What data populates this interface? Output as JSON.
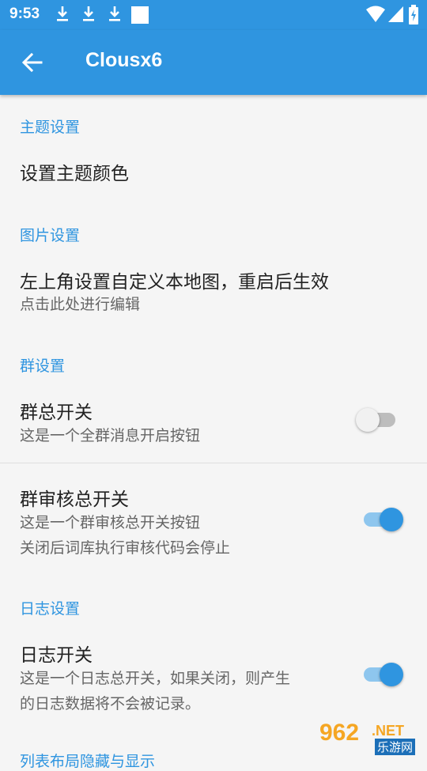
{
  "status_bar": {
    "time": "9:53"
  },
  "app_bar": {
    "title": "Clousx6"
  },
  "sections": {
    "theme": {
      "header": "主题设置",
      "item_title": "设置主题颜色"
    },
    "image": {
      "header": "图片设置",
      "item_title": "左上角设置自定义本地图，重启后生效",
      "item_subtitle": "点击此处进行编辑"
    },
    "group": {
      "header": "群设置",
      "master_switch_title": "群总开关",
      "master_switch_subtitle": "这是一个全群消息开启按钮",
      "master_switch_on": false,
      "review_switch_title": "群审核总开关",
      "review_switch_subtitle_1": "这是一个群审核总开关按钮",
      "review_switch_subtitle_2": "关闭后词库执行审核代码会停止",
      "review_switch_on": true
    },
    "log": {
      "header": "日志设置",
      "switch_title": "日志开关",
      "switch_subtitle_1": "这是一个日志总开关，如果关闭，则产生",
      "switch_subtitle_2": "的日志数据将不会被记录。",
      "switch_on": true
    },
    "list": {
      "header": "列表布局隐藏与显示"
    }
  },
  "watermark": {
    "number": "962",
    "suffix": ".NET",
    "site": "乐游网"
  },
  "colors": {
    "primary": "#2f95e0",
    "background": "#f5f5f5"
  }
}
